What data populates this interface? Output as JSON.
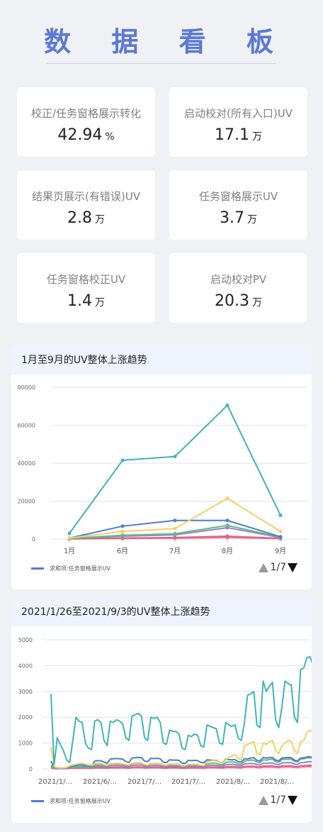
{
  "page": {
    "title": "数 据 看 板"
  },
  "kpis": [
    {
      "label": "校正/任务窗格展示转化",
      "value": "42.94",
      "unit": "%"
    },
    {
      "label": "启动校对(所有入口)UV",
      "value": "17.1",
      "unit": "万"
    },
    {
      "label": "结果页展示(有错误)UV",
      "value": "2.8",
      "unit": "万"
    },
    {
      "label": "任务窗格展示UV",
      "value": "3.7",
      "unit": "万"
    },
    {
      "label": "任务窗格校正UV",
      "value": "1.4",
      "unit": "万"
    },
    {
      "label": "启动校对PV",
      "value": "20.3",
      "unit": "万"
    }
  ],
  "chart1": {
    "title": "1月至9月的UV整体上涨趋势",
    "legend": "求和项:任务窗格展示UV",
    "pager": "1/7"
  },
  "chart2": {
    "title": "2021/1/26至2021/9/3的UV整体上涨趋势",
    "legend": "求和项:任务窗格展示UV",
    "pager": "1/7"
  },
  "colors": {
    "accent": "#5b78d4",
    "teal": "#40b4b8",
    "blue": "#4f7bd0",
    "yellow": "#f2d064",
    "green": "#5bbf7c",
    "purple": "#9a7fcf",
    "red": "#e0607e",
    "pink": "#e87aa8"
  },
  "chart_data": [
    {
      "type": "line",
      "categories": [
        "1月",
        "6月",
        "7月",
        "8月",
        "9月"
      ],
      "ylim": [
        0,
        80000
      ],
      "yticks": [
        0,
        20000,
        40000,
        60000,
        80000
      ],
      "grid": true,
      "legend_position": "bottom-left",
      "series": [
        {
          "values": [
            3000,
            41500,
            43500,
            70500,
            12500
          ],
          "color": "#40b4b8"
        },
        {
          "values": [
            500,
            4000,
            5500,
            21500,
            4000
          ],
          "color": "#f2d064"
        },
        {
          "name": "求和项:任务窗格展示UV",
          "values": [
            500,
            6800,
            9800,
            9800,
            1200
          ],
          "color": "#4f7bd0"
        },
        {
          "values": [
            300,
            2000,
            2800,
            7200,
            1000
          ],
          "color": "#5bbf7c"
        },
        {
          "values": [
            200,
            1500,
            2200,
            6000,
            800
          ],
          "color": "#9a7fcf"
        },
        {
          "values": [
            100,
            500,
            800,
            1500,
            400
          ],
          "color": "#e0607e"
        },
        {
          "values": [
            50,
            300,
            400,
            800,
            200
          ],
          "color": "#e87aa8"
        }
      ]
    },
    {
      "type": "line",
      "x_tick_labels": [
        "2021/1/...",
        "2021/6/...",
        "2021/7/...",
        "2021/7/...",
        "2021/8/...",
        "2021/8/..."
      ],
      "ylim": [
        0,
        5000
      ],
      "yticks": [
        0,
        1000,
        2000,
        3000,
        4000,
        5000
      ],
      "grid": true,
      "legend_position": "bottom-left",
      "series": [
        {
          "values": [
            2900,
            150,
            1200,
            950,
            700,
            350,
            250,
            1100,
            2000,
            1850,
            1800,
            1000,
            800,
            750,
            1850,
            1900,
            1800,
            1100,
            900,
            1850,
            1800,
            1900,
            1850,
            1750,
            1200,
            1100,
            2050,
            2100,
            2150,
            2050,
            1200,
            1100,
            2000,
            1950,
            2000,
            1800,
            1000,
            950,
            1500,
            1450,
            1450,
            1350,
            800,
            750,
            1300,
            1250,
            1350,
            1300,
            900,
            850,
            1700,
            1650,
            1600,
            1550,
            1000,
            950,
            1800,
            1700,
            1650,
            1700,
            1200,
            1100,
            1800,
            2850,
            2900,
            3000,
            1700,
            1600,
            3400,
            3000,
            3200,
            3350,
            1900,
            1600,
            2400,
            3400,
            3300,
            3250,
            2000,
            1800,
            3850,
            3900,
            4300,
            4350,
            4000
          ],
          "color": "#40b4b8"
        },
        {
          "values": [
            850,
            80,
            50,
            30,
            40,
            60,
            120,
            150,
            180,
            200,
            220,
            180,
            150,
            140,
            200,
            220,
            210,
            170,
            140,
            200,
            210,
            220,
            210,
            200,
            170,
            150,
            220,
            230,
            240,
            230,
            170,
            150,
            220,
            210,
            220,
            200,
            150,
            140,
            200,
            190,
            190,
            180,
            130,
            120,
            180,
            170,
            180,
            170,
            140,
            130,
            280,
            300,
            320,
            300,
            250,
            240,
            350,
            450,
            500,
            550,
            400,
            350,
            900,
            950,
            1000,
            1050,
            600,
            550,
            1000,
            950,
            1050,
            1100,
            700,
            600,
            900,
            1000,
            1100,
            1050,
            700,
            600,
            1050,
            1100,
            1400,
            1500,
            1400
          ],
          "color": "#f2d064"
        },
        {
          "name": "求和项:任务窗格展示UV",
          "values": [
            300,
            60,
            40,
            30,
            40,
            50,
            90,
            110,
            130,
            150,
            160,
            130,
            110,
            100,
            300,
            320,
            310,
            260,
            220,
            380,
            390,
            400,
            390,
            380,
            280,
            250,
            420,
            430,
            440,
            430,
            300,
            280,
            410,
            400,
            410,
            390,
            260,
            240,
            350,
            340,
            340,
            330,
            220,
            210,
            330,
            320,
            330,
            320,
            250,
            240,
            350,
            340,
            330,
            320,
            250,
            240,
            380,
            360,
            350,
            360,
            280,
            260,
            390,
            380,
            420,
            430,
            330,
            310,
            440,
            420,
            430,
            440,
            340,
            310,
            420,
            430,
            440,
            430,
            340,
            310,
            420,
            430,
            460,
            470,
            440
          ],
          "color": "#4f7bd0"
        },
        {
          "values": [
            150,
            40,
            30,
            20,
            30,
            40,
            60,
            70,
            80,
            90,
            100,
            80,
            70,
            60,
            150,
            160,
            155,
            130,
            110,
            180,
            190,
            200,
            190,
            180,
            140,
            125,
            210,
            215,
            220,
            215,
            150,
            140,
            205,
            200,
            205,
            195,
            130,
            120,
            175,
            170,
            170,
            165,
            110,
            105,
            165,
            160,
            165,
            160,
            125,
            120,
            200,
            210,
            220,
            210,
            170,
            160,
            250,
            260,
            270,
            260,
            200,
            180,
            300,
            320,
            340,
            330,
            260,
            240,
            350,
            340,
            360,
            370,
            280,
            250,
            360,
            370,
            380,
            370,
            290,
            270,
            380,
            390,
            420,
            430,
            400
          ],
          "color": "#5bbf7c"
        },
        {
          "values": [
            100,
            30,
            20,
            15,
            20,
            30,
            40,
            50,
            55,
            60,
            65,
            55,
            50,
            45,
            100,
            110,
            105,
            90,
            80,
            120,
            125,
            130,
            125,
            120,
            95,
            85,
            140,
            145,
            150,
            145,
            100,
            95,
            135,
            130,
            135,
            130,
            90,
            85,
            115,
            110,
            110,
            105,
            75,
            70,
            110,
            105,
            110,
            105,
            85,
            80,
            130,
            135,
            140,
            135,
            110,
            105,
            160,
            165,
            170,
            165,
            130,
            120,
            190,
            200,
            210,
            205,
            165,
            150,
            220,
            215,
            225,
            230,
            180,
            160,
            230,
            235,
            240,
            235,
            185,
            170,
            240,
            245,
            270,
            280,
            260
          ],
          "color": "#9a7fcf"
        },
        {
          "values": [
            50,
            20,
            15,
            10,
            15,
            20,
            25,
            30,
            35,
            40,
            40,
            35,
            30,
            28,
            50,
            55,
            52,
            45,
            40,
            60,
            62,
            65,
            62,
            60,
            48,
            42,
            70,
            72,
            75,
            72,
            50,
            48,
            68,
            65,
            68,
            65,
            45,
            42,
            58,
            55,
            55,
            52,
            38,
            35,
            55,
            52,
            55,
            52,
            42,
            40,
            65,
            68,
            70,
            68,
            55,
            52,
            80,
            82,
            85,
            82,
            65,
            60,
            95,
            100,
            105,
            102,
            82,
            75,
            110,
            108,
            112,
            115,
            90,
            80,
            115,
            118,
            120,
            118,
            92,
            85,
            120,
            122,
            135,
            140,
            130
          ],
          "color": "#e0607e"
        },
        {
          "values": [
            30,
            10,
            8,
            6,
            8,
            10,
            15,
            18,
            20,
            22,
            24,
            20,
            18,
            16,
            30,
            32,
            31,
            27,
            24,
            36,
            37,
            39,
            37,
            36,
            29,
            25,
            42,
            43,
            45,
            43,
            30,
            29,
            41,
            39,
            41,
            39,
            27,
            25,
            35,
            33,
            33,
            31,
            23,
            21,
            33,
            31,
            33,
            31,
            25,
            24,
            39,
            41,
            42,
            41,
            33,
            31,
            48,
            49,
            51,
            49,
            39,
            36,
            57,
            60,
            63,
            61,
            49,
            45,
            66,
            65,
            67,
            69,
            54,
            48,
            69,
            71,
            72,
            71,
            55,
            51,
            72,
            73,
            81,
            84,
            78
          ],
          "color": "#e87aa8"
        }
      ]
    }
  ]
}
